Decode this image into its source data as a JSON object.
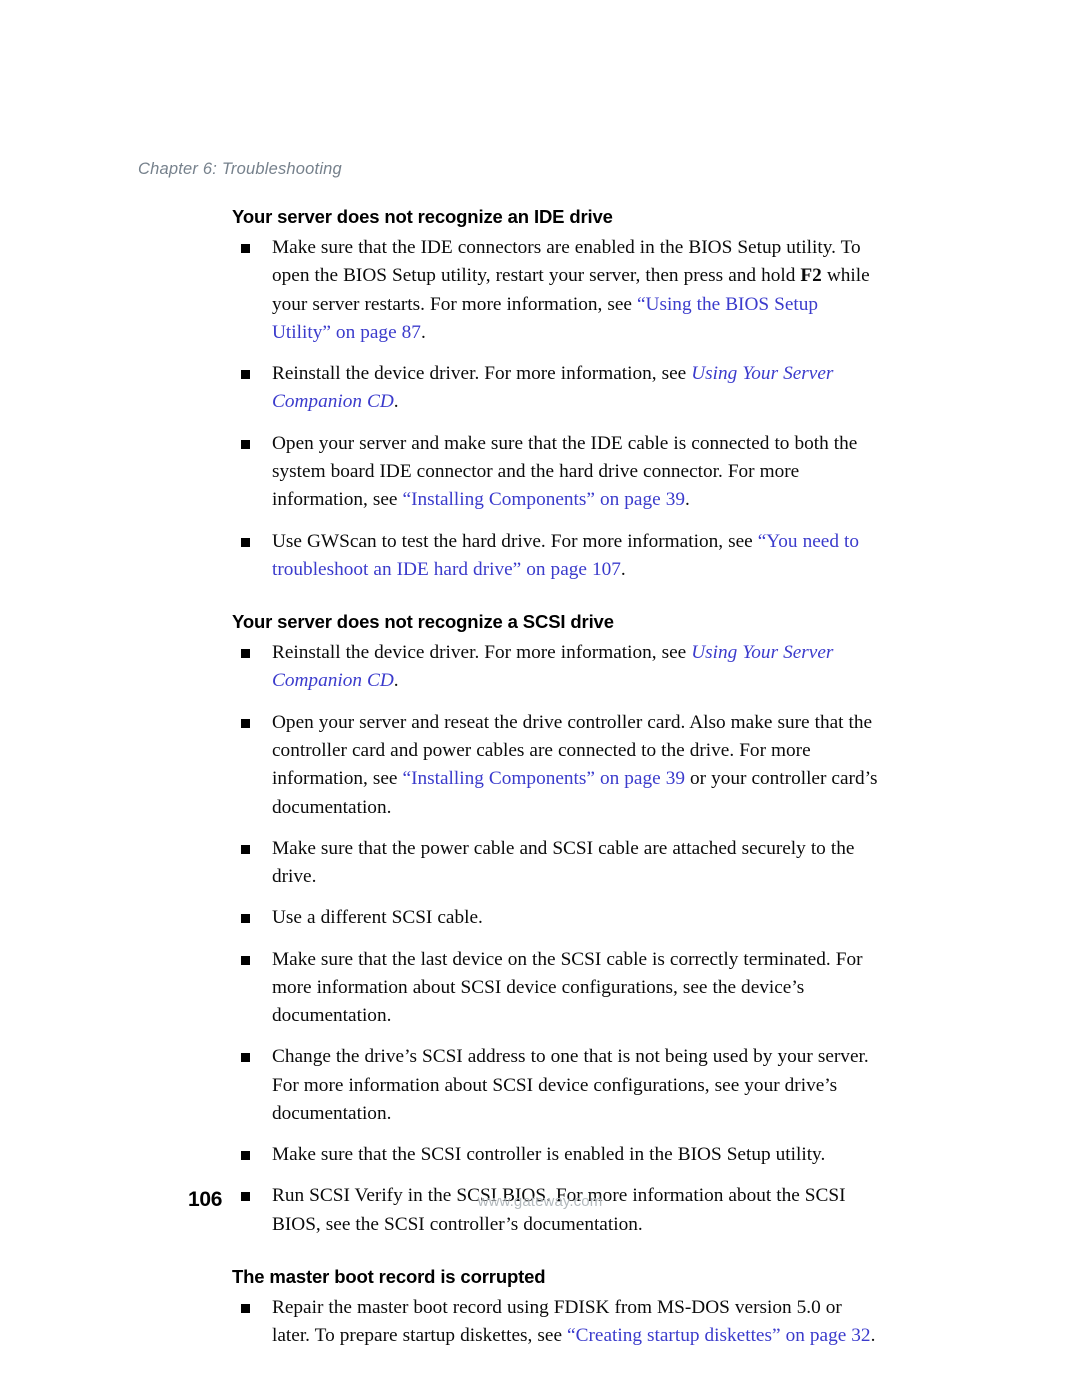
{
  "page": {
    "running_header": "Chapter 6: Troubleshooting",
    "page_number": "106",
    "footer_url": "www.gateway.com",
    "link_color": "#3b3bcc",
    "header_color": "#76818c",
    "footer_url_color": "#b3b9bd",
    "body_color": "#0b0b0b"
  },
  "sections": [
    {
      "heading": "Your server does not recognize an IDE drive",
      "bullets": [
        {
          "parts": [
            {
              "text": "Make sure that the IDE connectors are enabled in the BIOS Setup utility. To open the BIOS Setup utility, restart your server, then press and hold ",
              "style": "plain"
            },
            {
              "text": "F2",
              "style": "bold"
            },
            {
              "text": " while your server restarts. For more information, see ",
              "style": "plain"
            },
            {
              "text": "“Using the BIOS Setup Utility” on page 87",
              "style": "link"
            },
            {
              "text": ".",
              "style": "plain"
            }
          ]
        },
        {
          "parts": [
            {
              "text": "Reinstall the device driver. For more information, see ",
              "style": "plain"
            },
            {
              "text": "Using Your Server Companion CD",
              "style": "link-italic"
            },
            {
              "text": ".",
              "style": "plain"
            }
          ]
        },
        {
          "parts": [
            {
              "text": "Open your server and make sure that the IDE cable is connected to both the system board IDE connector and the hard drive connector. For more information, see ",
              "style": "plain"
            },
            {
              "text": "“Installing Components” on page 39",
              "style": "link"
            },
            {
              "text": ".",
              "style": "plain"
            }
          ]
        },
        {
          "parts": [
            {
              "text": "Use GWScan to test the hard drive. For more information, see ",
              "style": "plain"
            },
            {
              "text": "“You need to troubleshoot an IDE hard drive” on page 107",
              "style": "link"
            },
            {
              "text": ".",
              "style": "plain"
            }
          ]
        }
      ]
    },
    {
      "heading": "Your server does not recognize a SCSI drive",
      "bullets": [
        {
          "parts": [
            {
              "text": "Reinstall the device driver. For more information, see ",
              "style": "plain"
            },
            {
              "text": "Using Your Server Companion CD",
              "style": "link-italic"
            },
            {
              "text": ".",
              "style": "plain"
            }
          ]
        },
        {
          "parts": [
            {
              "text": "Open your server and reseat the drive controller card. Also make sure that the controller card and power cables are connected to the drive. For more information, see ",
              "style": "plain"
            },
            {
              "text": "“Installing Components” on page 39",
              "style": "link"
            },
            {
              "text": " or your controller card’s documentation.",
              "style": "plain"
            }
          ]
        },
        {
          "parts": [
            {
              "text": "Make sure that the power cable and SCSI cable are attached securely to the drive.",
              "style": "plain"
            }
          ]
        },
        {
          "parts": [
            {
              "text": "Use a different SCSI cable.",
              "style": "plain"
            }
          ]
        },
        {
          "parts": [
            {
              "text": "Make sure that the last device on the SCSI cable is correctly terminated. For more information about SCSI device configurations, see the device’s documentation.",
              "style": "plain"
            }
          ]
        },
        {
          "parts": [
            {
              "text": "Change the drive’s SCSI address to one that is not being used by your server. For more information about SCSI device configurations, see your drive’s documentation.",
              "style": "plain"
            }
          ]
        },
        {
          "parts": [
            {
              "text": "Make sure that the SCSI controller is enabled in the BIOS Setup utility.",
              "style": "plain"
            }
          ]
        },
        {
          "parts": [
            {
              "text": "Run SCSI Verify in the SCSI BIOS. For more information about the SCSI BIOS, see the SCSI controller’s documentation.",
              "style": "plain"
            }
          ]
        }
      ]
    },
    {
      "heading": "The master boot record is corrupted",
      "bullets": [
        {
          "parts": [
            {
              "text": "Repair the master boot record using FDISK from MS-DOS version 5.0 or later. To prepare startup diskettes, see ",
              "style": "plain"
            },
            {
              "text": "“Creating startup diskettes” on page 32",
              "style": "link"
            },
            {
              "text": ".",
              "style": "plain"
            }
          ]
        }
      ]
    }
  ]
}
